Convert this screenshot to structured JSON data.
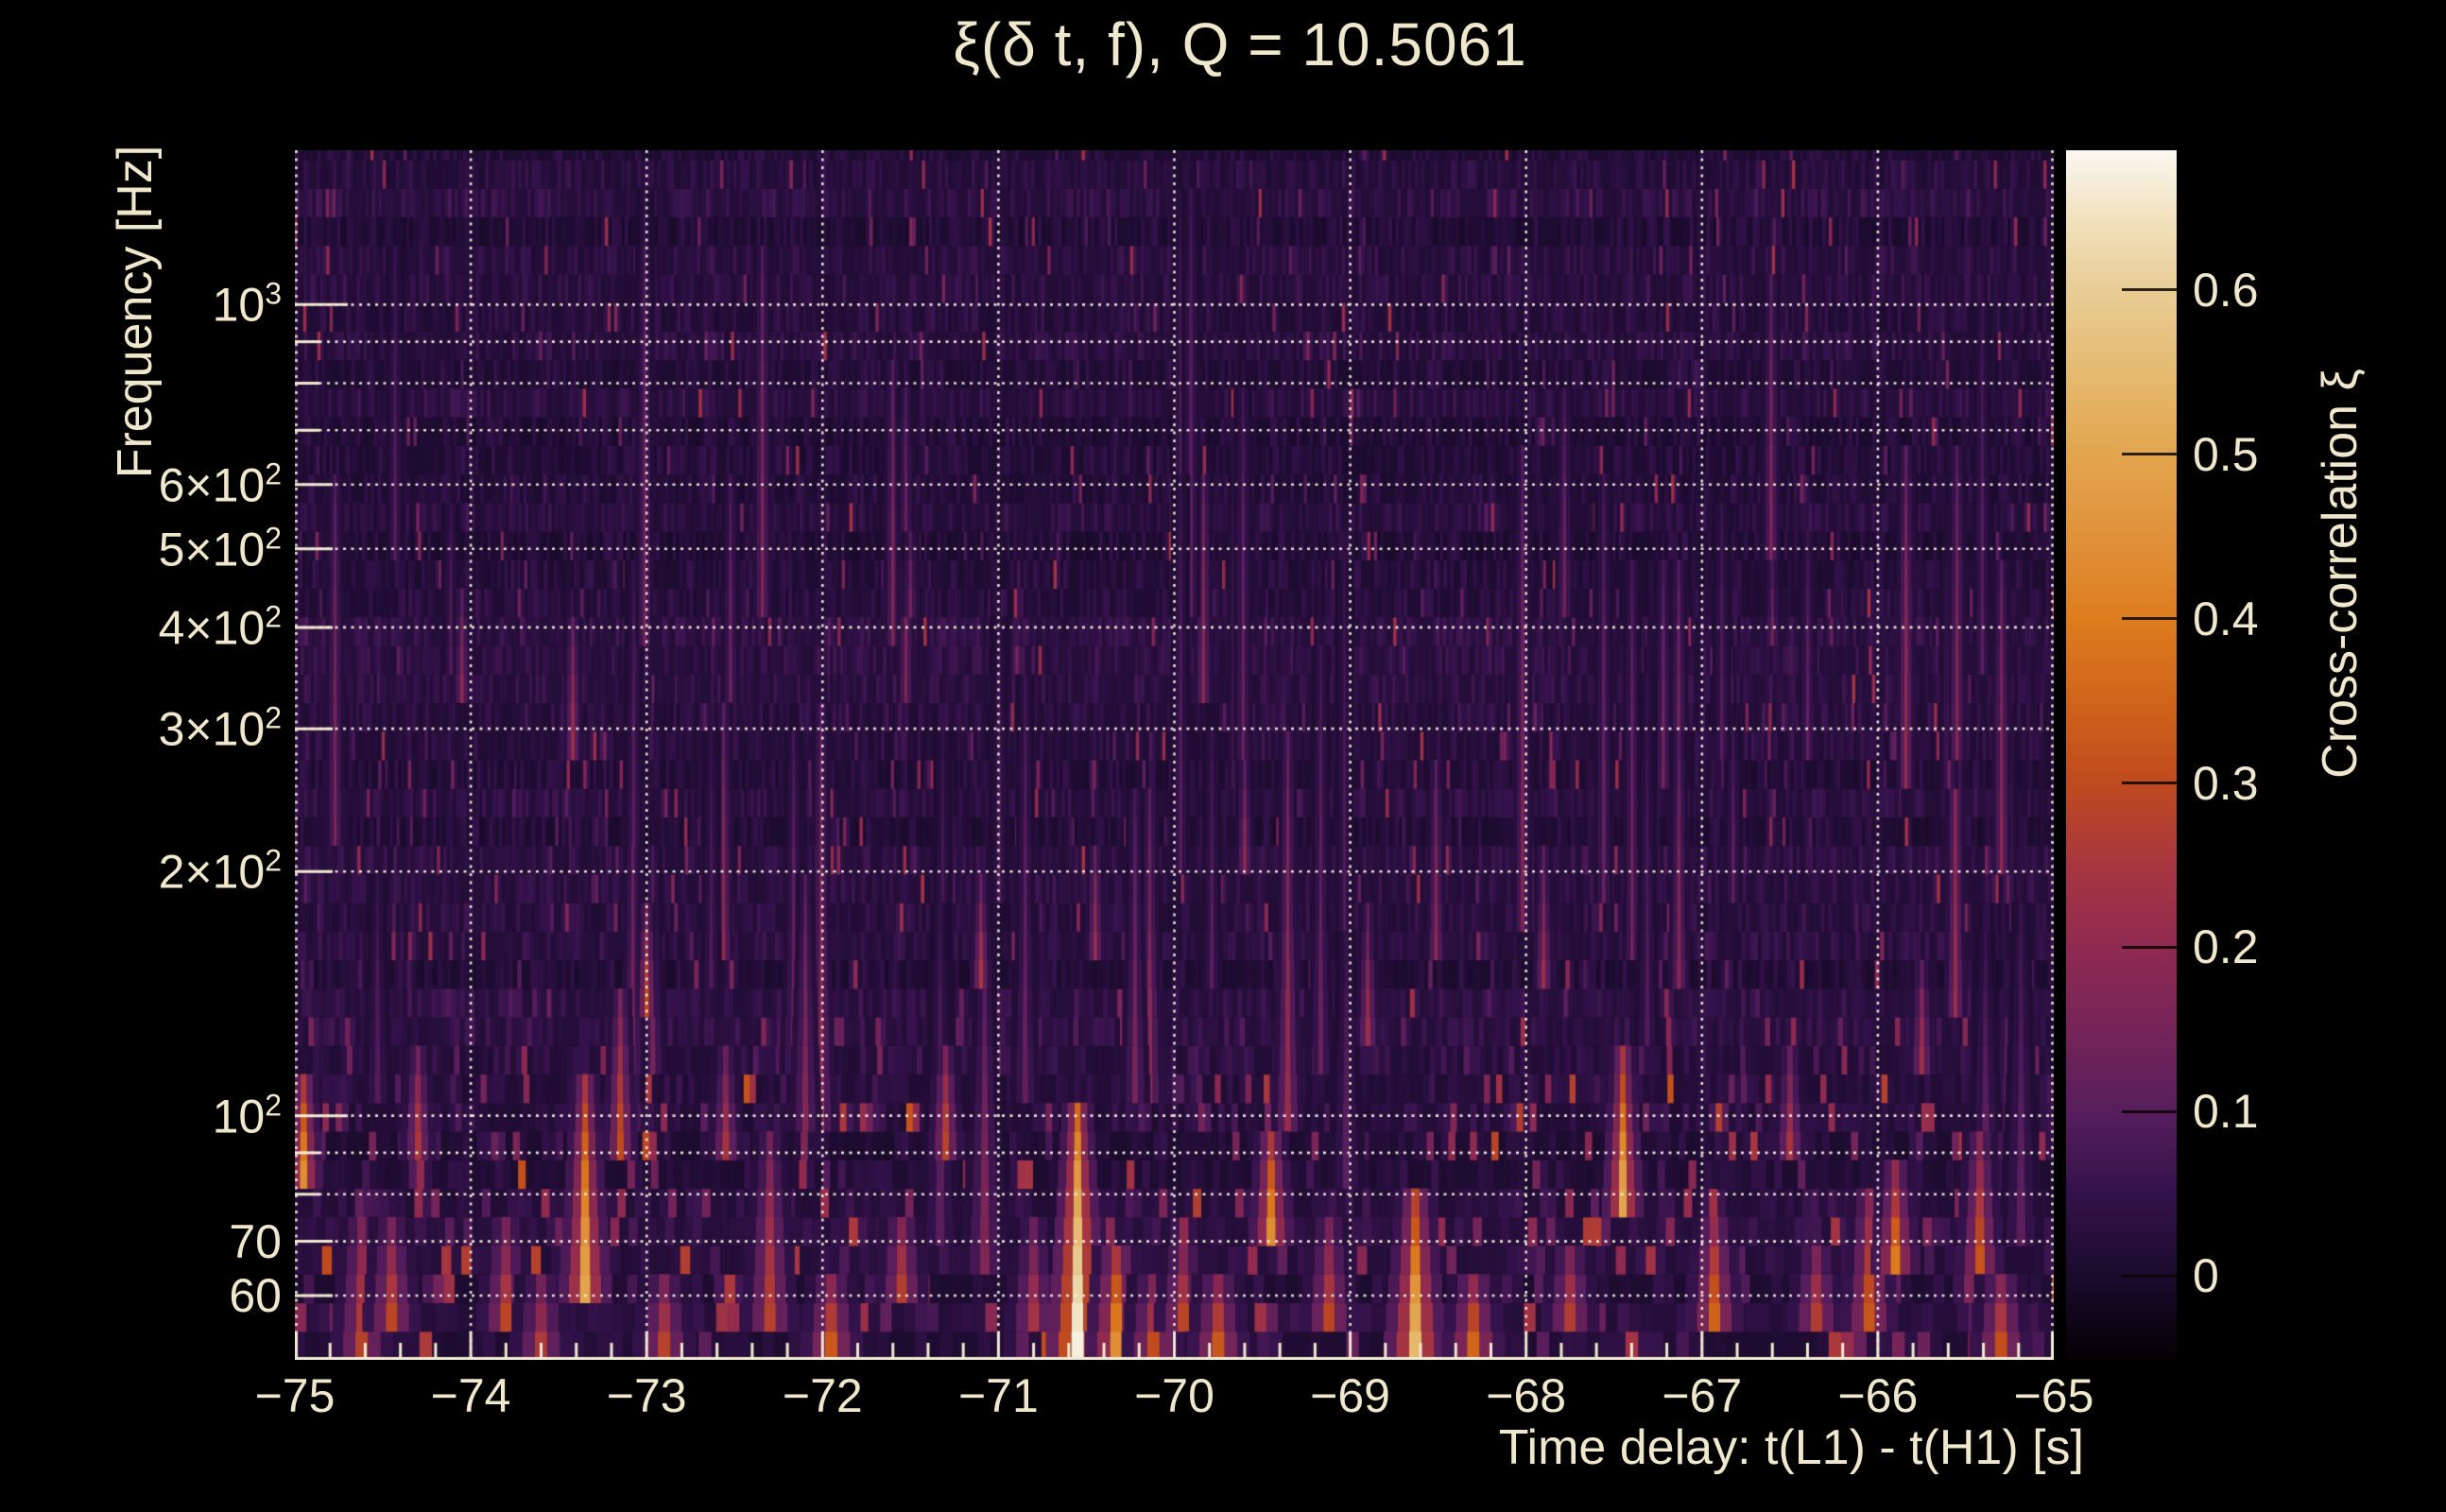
{
  "page": {
    "background": "#000000",
    "text_color": "#f0e8cd"
  },
  "chart_data": {
    "type": "heatmap",
    "title": "ξ(δ t, f), Q = 10.5061",
    "xlabel": "Time delay: t(L1) - t(H1) [s]",
    "ylabel": "Frequency [Hz]",
    "colorbar_label": "Cross-correlation ξ",
    "x_range": [
      -75,
      -65
    ],
    "y_range_hz": [
      50,
      1550
    ],
    "y_scale": "log",
    "grid": "dotted",
    "x_tick_labels": [
      {
        "v": -75,
        "label": "−75"
      },
      {
        "v": -74,
        "label": "−74"
      },
      {
        "v": -73,
        "label": "−73"
      },
      {
        "v": -72,
        "label": "−72"
      },
      {
        "v": -71,
        "label": "−71"
      },
      {
        "v": -70,
        "label": "−70"
      },
      {
        "v": -69,
        "label": "−69"
      },
      {
        "v": -68,
        "label": "−68"
      },
      {
        "v": -67,
        "label": "−67"
      },
      {
        "v": -66,
        "label": "−66"
      },
      {
        "v": -65,
        "label": "−65"
      }
    ],
    "x_minor_tick_step": 0.2,
    "y_tick_labels": [
      {
        "f": 1000,
        "text": "10",
        "sup": "3"
      },
      {
        "f": 600,
        "text": "6×10",
        "sup": "2"
      },
      {
        "f": 500,
        "text": "5×10",
        "sup": "2"
      },
      {
        "f": 400,
        "text": "4×10",
        "sup": "2"
      },
      {
        "f": 300,
        "text": "3×10",
        "sup": "2"
      },
      {
        "f": 200,
        "text": "2×10",
        "sup": "2"
      },
      {
        "f": 100,
        "text": "10",
        "sup": "2"
      },
      {
        "f": 70,
        "text": "70"
      },
      {
        "f": 60,
        "text": "60"
      }
    ],
    "y_gridlines_hz": [
      1000,
      900,
      800,
      700,
      600,
      500,
      400,
      300,
      200,
      100,
      90,
      80,
      70,
      60
    ],
    "colorbar": {
      "min": -0.051,
      "max": 0.685,
      "tick_labels": [
        {
          "v": 0.6,
          "label": "0.6"
        },
        {
          "v": 0.5,
          "label": "0.5"
        },
        {
          "v": 0.4,
          "label": "0.4"
        },
        {
          "v": 0.3,
          "label": "0.3"
        },
        {
          "v": 0.2,
          "label": "0.2"
        },
        {
          "v": 0.1,
          "label": "0.1"
        },
        {
          "v": 0.0,
          "label": "0"
        }
      ],
      "palette": [
        {
          "v": -0.051,
          "c": "#030204"
        },
        {
          "v": 0.0,
          "c": "#1a0b2c"
        },
        {
          "v": 0.05,
          "c": "#33124a"
        },
        {
          "v": 0.1,
          "c": "#571e5c"
        },
        {
          "v": 0.15,
          "c": "#752458"
        },
        {
          "v": 0.2,
          "c": "#8f2a50"
        },
        {
          "v": 0.25,
          "c": "#a73640"
        },
        {
          "v": 0.3,
          "c": "#bf4a1e"
        },
        {
          "v": 0.35,
          "c": "#d0641a"
        },
        {
          "v": 0.4,
          "c": "#dd7d1e"
        },
        {
          "v": 0.45,
          "c": "#e0923a"
        },
        {
          "v": 0.5,
          "c": "#e2a54e"
        },
        {
          "v": 0.55,
          "c": "#e5ba70"
        },
        {
          "v": 0.6,
          "c": "#e8cd96"
        },
        {
          "v": 0.64,
          "c": "#f0e0ba"
        },
        {
          "v": 0.685,
          "c": "#faf7ef"
        }
      ]
    },
    "hotspots": [
      {
        "dt": -74.95,
        "f_lo": 82,
        "f_hi": 112,
        "xi": 0.45
      },
      {
        "dt": -74.62,
        "f_lo": 52,
        "f_hi": 75,
        "xi": 0.28
      },
      {
        "dt": -74.45,
        "f_lo": 55,
        "f_hi": 72,
        "xi": 0.3
      },
      {
        "dt": -74.3,
        "f_lo": 95,
        "f_hi": 120,
        "xi": 0.25
      },
      {
        "dt": -74.05,
        "f_lo": 330,
        "f_hi": 430,
        "xi": 0.2
      },
      {
        "dt": -73.8,
        "f_lo": 55,
        "f_hi": 70,
        "xi": 0.3
      },
      {
        "dt": -73.6,
        "f_lo": 50,
        "f_hi": 60,
        "xi": 0.28
      },
      {
        "dt": -73.42,
        "f_lo": 290,
        "f_hi": 400,
        "xi": 0.22
      },
      {
        "dt": -73.35,
        "f_lo": 60,
        "f_hi": 108,
        "xi": 0.5
      },
      {
        "dt": -73.15,
        "f_lo": 95,
        "f_hi": 135,
        "xi": 0.3
      },
      {
        "dt": -73.0,
        "f_lo": 140,
        "f_hi": 175,
        "xi": 0.3
      },
      {
        "dt": -72.9,
        "f_lo": 50,
        "f_hi": 62,
        "xi": 0.3
      },
      {
        "dt": -72.55,
        "f_lo": 90,
        "f_hi": 115,
        "xi": 0.25
      },
      {
        "dt": -72.3,
        "f_lo": 55,
        "f_hi": 90,
        "xi": 0.28
      },
      {
        "dt": -71.95,
        "f_lo": 50,
        "f_hi": 62,
        "xi": 0.35
      },
      {
        "dt": -71.55,
        "f_lo": 60,
        "f_hi": 75,
        "xi": 0.28
      },
      {
        "dt": -71.5,
        "f_lo": 420,
        "f_hi": 520,
        "xi": 0.15
      },
      {
        "dt": -71.3,
        "f_lo": 95,
        "f_hi": 120,
        "xi": 0.28
      },
      {
        "dt": -71.1,
        "f_lo": 150,
        "f_hi": 190,
        "xi": 0.25
      },
      {
        "dt": -70.8,
        "f_lo": 55,
        "f_hi": 70,
        "xi": 0.25
      },
      {
        "dt": -70.55,
        "f_lo": 50,
        "f_hi": 102,
        "xi": 0.68
      },
      {
        "dt": -70.45,
        "f_lo": 160,
        "f_hi": 210,
        "xi": 0.22
      },
      {
        "dt": -70.33,
        "f_lo": 50,
        "f_hi": 68,
        "xi": 0.46
      },
      {
        "dt": -70.12,
        "f_lo": 50,
        "f_hi": 60,
        "xi": 0.33
      },
      {
        "dt": -69.95,
        "f_lo": 55,
        "f_hi": 68,
        "xi": 0.3
      },
      {
        "dt": -69.75,
        "f_lo": 50,
        "f_hi": 62,
        "xi": 0.35
      },
      {
        "dt": -69.6,
        "f_lo": 200,
        "f_hi": 260,
        "xi": 0.2
      },
      {
        "dt": -69.45,
        "f_lo": 70,
        "f_hi": 95,
        "xi": 0.45
      },
      {
        "dt": -69.12,
        "f_lo": 55,
        "f_hi": 70,
        "xi": 0.3
      },
      {
        "dt": -68.9,
        "f_lo": 130,
        "f_hi": 170,
        "xi": 0.22
      },
      {
        "dt": -68.63,
        "f_lo": 50,
        "f_hi": 76,
        "xi": 0.56
      },
      {
        "dt": -68.3,
        "f_lo": 50,
        "f_hi": 62,
        "xi": 0.38
      },
      {
        "dt": -68.02,
        "f_lo": 180,
        "f_hi": 620,
        "xi": 0.16
      },
      {
        "dt": -67.9,
        "f_lo": 150,
        "f_hi": 200,
        "xi": 0.22
      },
      {
        "dt": -67.75,
        "f_lo": 55,
        "f_hi": 68,
        "xi": 0.28
      },
      {
        "dt": -67.45,
        "f_lo": 80,
        "f_hi": 115,
        "xi": 0.5
      },
      {
        "dt": -66.93,
        "f_lo": 56,
        "f_hi": 75,
        "xi": 0.35
      },
      {
        "dt": -66.6,
        "f_lo": 380,
        "f_hi": 460,
        "xi": 0.15
      },
      {
        "dt": -66.5,
        "f_lo": 90,
        "f_hi": 115,
        "xi": 0.25
      },
      {
        "dt": -66.35,
        "f_lo": 55,
        "f_hi": 68,
        "xi": 0.28
      },
      {
        "dt": -66.05,
        "f_lo": 55,
        "f_hi": 80,
        "xi": 0.33
      },
      {
        "dt": -65.9,
        "f_lo": 66,
        "f_hi": 82,
        "xi": 0.4
      },
      {
        "dt": -65.75,
        "f_lo": 120,
        "f_hi": 150,
        "xi": 0.22
      },
      {
        "dt": -65.55,
        "f_lo": 280,
        "f_hi": 650,
        "xi": 0.18
      },
      {
        "dt": -65.42,
        "f_lo": 60,
        "f_hi": 90,
        "xi": 0.35
      },
      {
        "dt": -65.3,
        "f_lo": 50,
        "f_hi": 62,
        "xi": 0.33
      }
    ],
    "texture": {
      "seed": 1337,
      "rows_ratio": 1.0845,
      "faint_streaks": 58
    }
  }
}
